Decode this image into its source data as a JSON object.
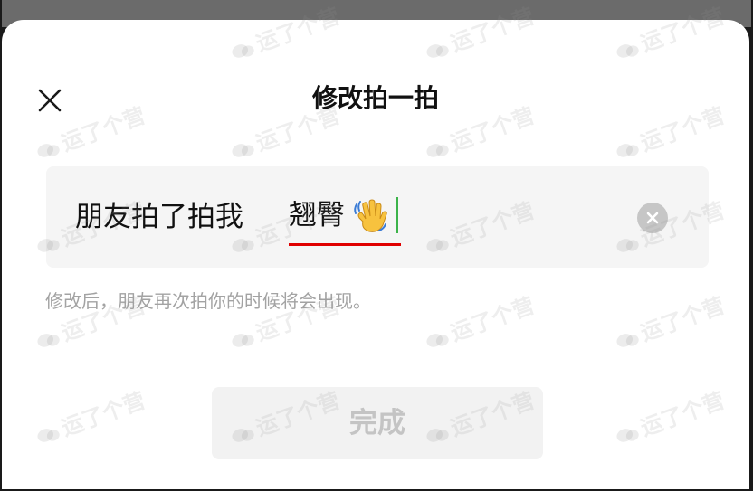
{
  "dialog": {
    "title": "修改拍一拍",
    "close_icon": "close-icon"
  },
  "pat_input": {
    "prefix": "朋友拍了拍我",
    "value": "翘臀",
    "emoji_icon": "waving-hand-icon",
    "clear_icon": "clear-circle-icon",
    "caret_color": "#3cb34a",
    "highlight_color": "#e00000"
  },
  "hint": "修改后，朋友再次拍你的时候将会出现。",
  "done_button": {
    "label": "完成",
    "enabled": false
  },
  "watermark": {
    "text": "运了个营",
    "logo_icon": "wechat-logo-icon"
  }
}
